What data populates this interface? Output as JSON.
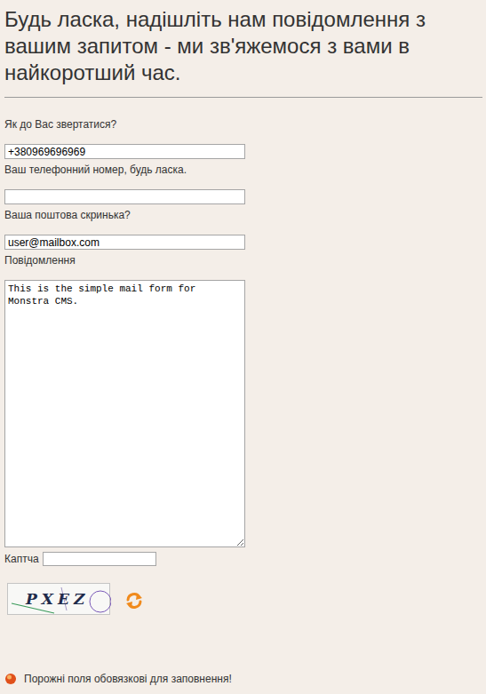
{
  "heading": "Будь ласка, надішліть нам повідомлення з вашим запитом - ми зв'яжемося з вами в найкоротший час.",
  "fields": [
    {
      "label": "Як до Вас звертатися?",
      "value": "+380969696969",
      "kind": "input"
    },
    {
      "label": "Ваш телефонний номер, будь ласка.",
      "value": "",
      "kind": "input"
    },
    {
      "label": "Ваша поштова скринька?",
      "value": "user@mailbox.com",
      "kind": "input"
    },
    {
      "label": "Повідомлення",
      "value": "This is the simple mail form for Monstra CMS.",
      "kind": "textarea"
    }
  ],
  "captcha": {
    "label": "Каптча",
    "value": "",
    "code": "PXEZ"
  },
  "note": "Порожні поля обовязкові для заповнення!"
}
